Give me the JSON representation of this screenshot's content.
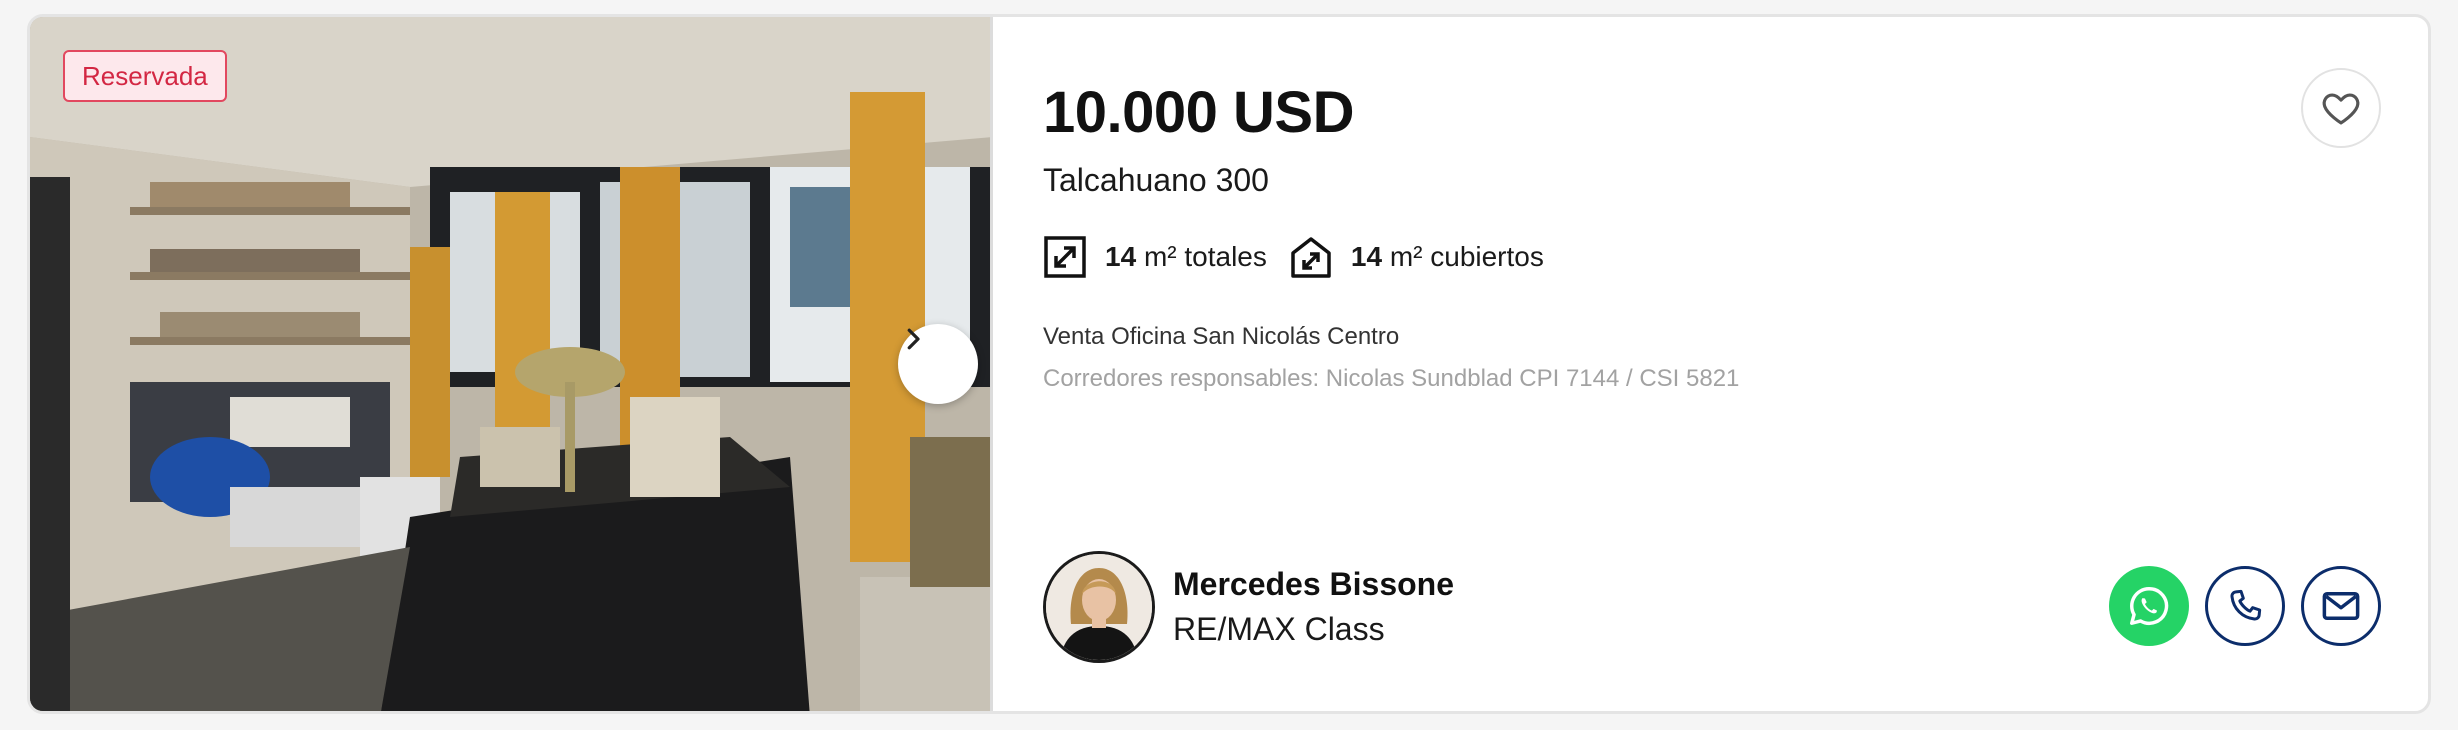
{
  "listing": {
    "badge": "Reservada",
    "price": "10.000 USD",
    "address": "Talcahuano 300",
    "features": {
      "total": {
        "value": "14",
        "unit": "m² totales"
      },
      "covered": {
        "value": "14",
        "unit": "m² cubiertos"
      }
    },
    "title": "Venta Oficina San Nicolás Centro",
    "brokers": "Corredores responsables: Nicolas Sundblad CPI 7144 / CSI 5821"
  },
  "agent": {
    "name": "Mercedes Bissone",
    "company": "RE/MAX Class"
  },
  "icons": {
    "next": "chevron-right-icon",
    "favorite": "heart-icon",
    "total_area": "total-area-icon",
    "covered_area": "covered-area-icon",
    "whatsapp": "whatsapp-icon",
    "phone": "phone-icon",
    "email": "email-icon"
  },
  "colors": {
    "badge_text": "#d32743",
    "badge_bg": "#fde8ec",
    "whatsapp": "#25d366",
    "brand_navy": "#0c2d6b"
  }
}
